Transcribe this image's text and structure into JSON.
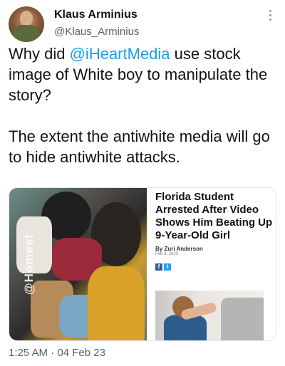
{
  "author": {
    "display_name": "Klaus Arminius",
    "handle": "@Klaus_Arminius"
  },
  "tweet": {
    "text_part1": "Why did ",
    "mention": "@iHeartMedia",
    "text_part2": " use stock image of White boy to manipulate the story?\n\nThe extent the antiwhite media will go to hide antiwhite attacks."
  },
  "media": {
    "watermark": "@Homest",
    "article": {
      "headline": "Florida Student Arrested After Video Shows Him Beating Up 9-Year-Old Girl",
      "byline": "By Zuri Anderson",
      "date": "Feb 3, 2023",
      "share_facebook": "f",
      "share_twitter": "t"
    }
  },
  "timestamp": "1:25 AM · 04 Feb 23",
  "colors": {
    "mention": "#1d9bf0",
    "secondary_text": "#536471"
  },
  "icons": [
    "more-options-icon",
    "facebook-icon",
    "twitter-icon"
  ]
}
